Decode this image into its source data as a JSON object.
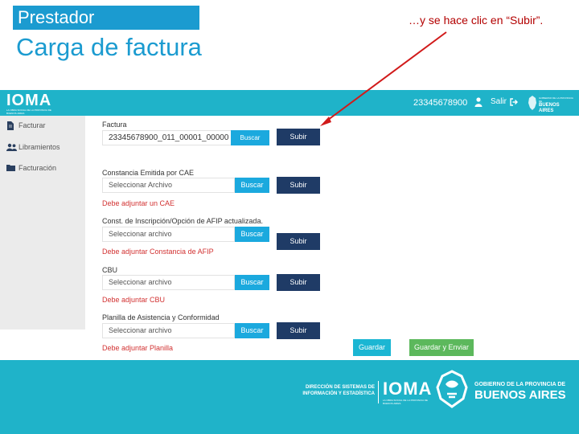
{
  "slide": {
    "tag": "Prestador",
    "title": "Carga de factura",
    "callout": "…y se hace clic en “Subir”."
  },
  "header": {
    "brand": "IOMA",
    "brand_tagline": "LA OBRA SOCIAL DE LA PROVINCIA DE BUENOS AIRES",
    "user_id": "23345678900",
    "logout_label": "Salir",
    "gov_logo_line1": "GOBIERNO DE LA PROVINCIA DE",
    "gov_logo_line2": "BUENOS AIRES"
  },
  "sidebar": {
    "items": [
      {
        "label": "Facturar",
        "icon": "document-icon"
      },
      {
        "label": "Libramientos",
        "icon": "people-icon"
      },
      {
        "label": "Facturación",
        "icon": "folder-icon"
      }
    ]
  },
  "form": {
    "invoice": {
      "label": "Factura",
      "file_value": "23345678900_011_00001_00000",
      "buscar_label": "Buscar",
      "subir_label": "Subir"
    },
    "fields": [
      {
        "label": "Constancia Emitida por CAE",
        "placeholder": "Seleccionar Archivo",
        "buscar_label": "Buscar",
        "subir_label": "Subir",
        "error": "Debe adjuntar un CAE"
      },
      {
        "label": "Const. de Inscripción/Opción de AFIP actualizada.",
        "placeholder": "Seleccionar archivo",
        "buscar_label": "Buscar",
        "subir_label": "Subir",
        "error": "Debe adjuntar Constancia de AFIP"
      },
      {
        "label": "CBU",
        "placeholder": "Seleccionar archivo",
        "buscar_label": "Buscar",
        "subir_label": "Subir",
        "error": "Debe adjuntar CBU"
      },
      {
        "label": "Planilla de Asistencia y Conformidad",
        "placeholder": "Seleccionar archivo",
        "buscar_label": "Buscar",
        "subir_label": "Subir",
        "error": "Debe adjuntar Planilla"
      }
    ],
    "save_label": "Guardar",
    "save_send_label": "Guardar y Enviar"
  },
  "footer": {
    "direccion": "DIRECCIÓN DE SISTEMAS DE INFORMACIÓN Y ESTADÍSTICA",
    "brand": "IOMA",
    "brand_tagline": "LA OBRA SOCIAL DE LA PROVINCIA DE BUENOS AIRES",
    "gov_line1": "GOBIERNO DE LA PROVINCIA DE",
    "gov_line2": "BUENOS AIRES"
  },
  "colors": {
    "accent": "#1fb3c9",
    "title": "#1b9bd0",
    "buscar": "#1ba9de",
    "subir": "#1f3b66",
    "error": "#d23232",
    "success": "#5cb85c",
    "annotation": "#b30000"
  }
}
